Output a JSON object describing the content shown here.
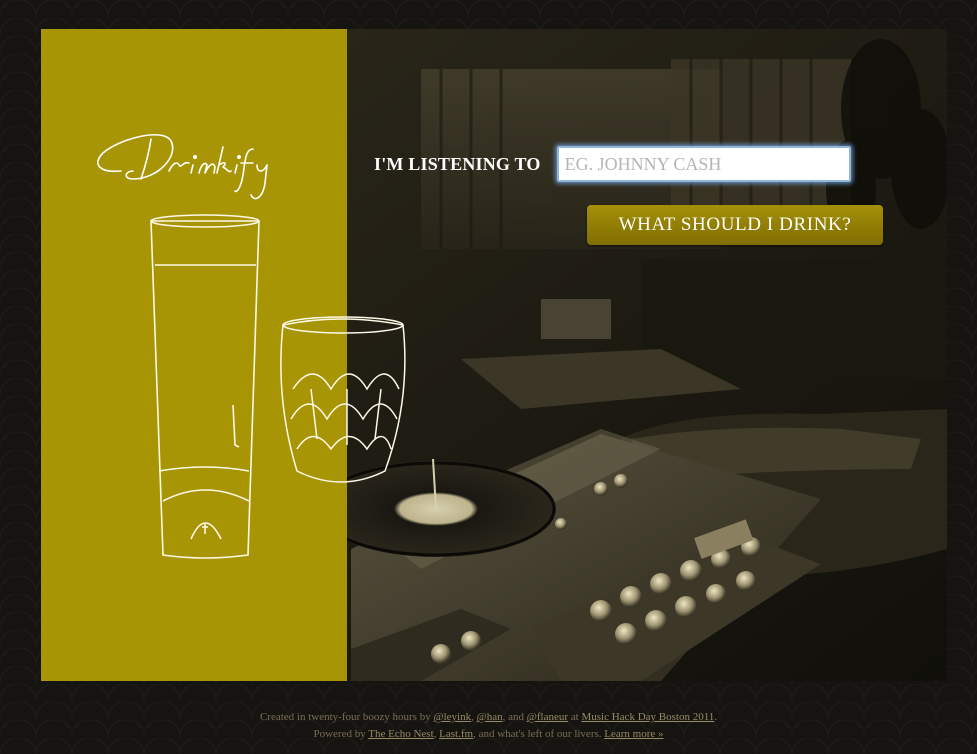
{
  "app": {
    "logo": "Drinkify"
  },
  "form": {
    "label": "I'M LISTENING TO",
    "input_placeholder": "EG. JOHNNY CASH",
    "input_value": "",
    "submit_label": "WHAT SHOULD I DRINK?"
  },
  "footer": {
    "line1": {
      "prefix": "Created in twenty-four boozy hours by ",
      "author1": "@leyink",
      "sep1": ", ",
      "author2": "@han",
      "sep2": ", and ",
      "author3": "@flaneur",
      "sep3": " at ",
      "event": "Music Hack Day Boston 2011",
      "suffix": "."
    },
    "line2": {
      "prefix": "Powered by ",
      "link1": "The Echo Nest",
      "sep1": ", ",
      "link2": "Last.fm",
      "middle": ", and what's left of our livers. ",
      "learn_more": "Learn more »"
    }
  },
  "colors": {
    "panel": "#a89506",
    "background": "#161410",
    "button": "#918003"
  },
  "icons": {
    "highball": "highball-glass-illustration",
    "rocks": "rocks-glass-illustration",
    "turntable": "turntable-illustration"
  }
}
